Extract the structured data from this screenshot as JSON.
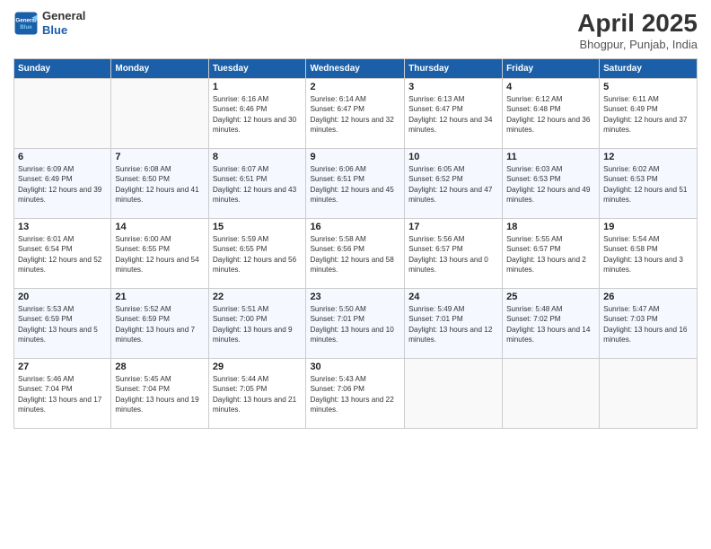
{
  "header": {
    "logo_line1": "General",
    "logo_line2": "Blue",
    "month": "April 2025",
    "location": "Bhogpur, Punjab, India"
  },
  "weekdays": [
    "Sunday",
    "Monday",
    "Tuesday",
    "Wednesday",
    "Thursday",
    "Friday",
    "Saturday"
  ],
  "weeks": [
    [
      {
        "day": "",
        "sunrise": "",
        "sunset": "",
        "daylight": ""
      },
      {
        "day": "",
        "sunrise": "",
        "sunset": "",
        "daylight": ""
      },
      {
        "day": "1",
        "sunrise": "Sunrise: 6:16 AM",
        "sunset": "Sunset: 6:46 PM",
        "daylight": "Daylight: 12 hours and 30 minutes."
      },
      {
        "day": "2",
        "sunrise": "Sunrise: 6:14 AM",
        "sunset": "Sunset: 6:47 PM",
        "daylight": "Daylight: 12 hours and 32 minutes."
      },
      {
        "day": "3",
        "sunrise": "Sunrise: 6:13 AM",
        "sunset": "Sunset: 6:47 PM",
        "daylight": "Daylight: 12 hours and 34 minutes."
      },
      {
        "day": "4",
        "sunrise": "Sunrise: 6:12 AM",
        "sunset": "Sunset: 6:48 PM",
        "daylight": "Daylight: 12 hours and 36 minutes."
      },
      {
        "day": "5",
        "sunrise": "Sunrise: 6:11 AM",
        "sunset": "Sunset: 6:49 PM",
        "daylight": "Daylight: 12 hours and 37 minutes."
      }
    ],
    [
      {
        "day": "6",
        "sunrise": "Sunrise: 6:09 AM",
        "sunset": "Sunset: 6:49 PM",
        "daylight": "Daylight: 12 hours and 39 minutes."
      },
      {
        "day": "7",
        "sunrise": "Sunrise: 6:08 AM",
        "sunset": "Sunset: 6:50 PM",
        "daylight": "Daylight: 12 hours and 41 minutes."
      },
      {
        "day": "8",
        "sunrise": "Sunrise: 6:07 AM",
        "sunset": "Sunset: 6:51 PM",
        "daylight": "Daylight: 12 hours and 43 minutes."
      },
      {
        "day": "9",
        "sunrise": "Sunrise: 6:06 AM",
        "sunset": "Sunset: 6:51 PM",
        "daylight": "Daylight: 12 hours and 45 minutes."
      },
      {
        "day": "10",
        "sunrise": "Sunrise: 6:05 AM",
        "sunset": "Sunset: 6:52 PM",
        "daylight": "Daylight: 12 hours and 47 minutes."
      },
      {
        "day": "11",
        "sunrise": "Sunrise: 6:03 AM",
        "sunset": "Sunset: 6:53 PM",
        "daylight": "Daylight: 12 hours and 49 minutes."
      },
      {
        "day": "12",
        "sunrise": "Sunrise: 6:02 AM",
        "sunset": "Sunset: 6:53 PM",
        "daylight": "Daylight: 12 hours and 51 minutes."
      }
    ],
    [
      {
        "day": "13",
        "sunrise": "Sunrise: 6:01 AM",
        "sunset": "Sunset: 6:54 PM",
        "daylight": "Daylight: 12 hours and 52 minutes."
      },
      {
        "day": "14",
        "sunrise": "Sunrise: 6:00 AM",
        "sunset": "Sunset: 6:55 PM",
        "daylight": "Daylight: 12 hours and 54 minutes."
      },
      {
        "day": "15",
        "sunrise": "Sunrise: 5:59 AM",
        "sunset": "Sunset: 6:55 PM",
        "daylight": "Daylight: 12 hours and 56 minutes."
      },
      {
        "day": "16",
        "sunrise": "Sunrise: 5:58 AM",
        "sunset": "Sunset: 6:56 PM",
        "daylight": "Daylight: 12 hours and 58 minutes."
      },
      {
        "day": "17",
        "sunrise": "Sunrise: 5:56 AM",
        "sunset": "Sunset: 6:57 PM",
        "daylight": "Daylight: 13 hours and 0 minutes."
      },
      {
        "day": "18",
        "sunrise": "Sunrise: 5:55 AM",
        "sunset": "Sunset: 6:57 PM",
        "daylight": "Daylight: 13 hours and 2 minutes."
      },
      {
        "day": "19",
        "sunrise": "Sunrise: 5:54 AM",
        "sunset": "Sunset: 6:58 PM",
        "daylight": "Daylight: 13 hours and 3 minutes."
      }
    ],
    [
      {
        "day": "20",
        "sunrise": "Sunrise: 5:53 AM",
        "sunset": "Sunset: 6:59 PM",
        "daylight": "Daylight: 13 hours and 5 minutes."
      },
      {
        "day": "21",
        "sunrise": "Sunrise: 5:52 AM",
        "sunset": "Sunset: 6:59 PM",
        "daylight": "Daylight: 13 hours and 7 minutes."
      },
      {
        "day": "22",
        "sunrise": "Sunrise: 5:51 AM",
        "sunset": "Sunset: 7:00 PM",
        "daylight": "Daylight: 13 hours and 9 minutes."
      },
      {
        "day": "23",
        "sunrise": "Sunrise: 5:50 AM",
        "sunset": "Sunset: 7:01 PM",
        "daylight": "Daylight: 13 hours and 10 minutes."
      },
      {
        "day": "24",
        "sunrise": "Sunrise: 5:49 AM",
        "sunset": "Sunset: 7:01 PM",
        "daylight": "Daylight: 13 hours and 12 minutes."
      },
      {
        "day": "25",
        "sunrise": "Sunrise: 5:48 AM",
        "sunset": "Sunset: 7:02 PM",
        "daylight": "Daylight: 13 hours and 14 minutes."
      },
      {
        "day": "26",
        "sunrise": "Sunrise: 5:47 AM",
        "sunset": "Sunset: 7:03 PM",
        "daylight": "Daylight: 13 hours and 16 minutes."
      }
    ],
    [
      {
        "day": "27",
        "sunrise": "Sunrise: 5:46 AM",
        "sunset": "Sunset: 7:04 PM",
        "daylight": "Daylight: 13 hours and 17 minutes."
      },
      {
        "day": "28",
        "sunrise": "Sunrise: 5:45 AM",
        "sunset": "Sunset: 7:04 PM",
        "daylight": "Daylight: 13 hours and 19 minutes."
      },
      {
        "day": "29",
        "sunrise": "Sunrise: 5:44 AM",
        "sunset": "Sunset: 7:05 PM",
        "daylight": "Daylight: 13 hours and 21 minutes."
      },
      {
        "day": "30",
        "sunrise": "Sunrise: 5:43 AM",
        "sunset": "Sunset: 7:06 PM",
        "daylight": "Daylight: 13 hours and 22 minutes."
      },
      {
        "day": "",
        "sunrise": "",
        "sunset": "",
        "daylight": ""
      },
      {
        "day": "",
        "sunrise": "",
        "sunset": "",
        "daylight": ""
      },
      {
        "day": "",
        "sunrise": "",
        "sunset": "",
        "daylight": ""
      }
    ]
  ]
}
